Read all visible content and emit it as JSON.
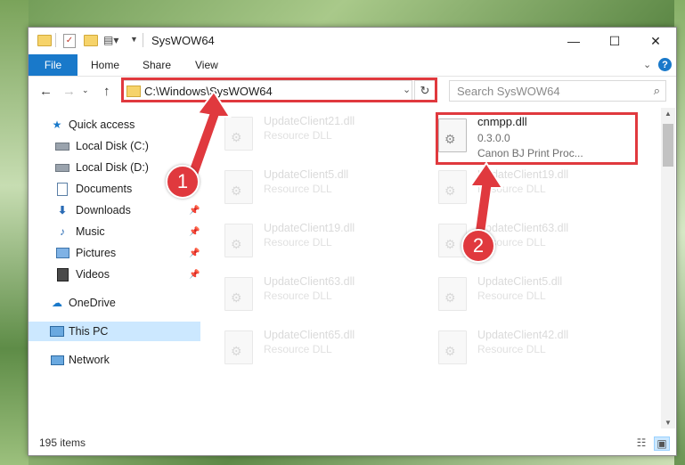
{
  "window": {
    "title": "SysWOW64"
  },
  "title_controls": {
    "minimize": "—",
    "maximize": "☐",
    "close": "✕"
  },
  "ribbon": {
    "tabs": [
      "File",
      "Home",
      "Share",
      "View"
    ],
    "help": "?"
  },
  "nav": {
    "address": "C:\\Windows\\SysWOW64",
    "search_placeholder": "Search SysWOW64"
  },
  "sidebar": {
    "items": [
      {
        "label": "Quick access",
        "icon": "star-icon",
        "pinned": false
      },
      {
        "label": "Local Disk (C:)",
        "icon": "drive-icon",
        "pinned": false
      },
      {
        "label": "Local Disk (D:)",
        "icon": "drive-icon",
        "pinned": false
      },
      {
        "label": "Documents",
        "icon": "documents-icon",
        "pinned": false
      },
      {
        "label": "Downloads",
        "icon": "downloads-icon",
        "pinned": true
      },
      {
        "label": "Music",
        "icon": "music-icon",
        "pinned": true
      },
      {
        "label": "Pictures",
        "icon": "pictures-icon",
        "pinned": true
      },
      {
        "label": "Videos",
        "icon": "videos-icon",
        "pinned": true
      },
      {
        "label": "OneDrive",
        "icon": "onedrive-icon",
        "pinned": false
      },
      {
        "label": "This PC",
        "icon": "this-pc-icon",
        "pinned": false,
        "selected": true
      },
      {
        "label": "Network",
        "icon": "network-icon",
        "pinned": false
      }
    ]
  },
  "files": [
    {
      "name": "UpdateClient21.dll",
      "desc": "Resource DLL"
    },
    {
      "name": "cnmpp.dll",
      "desc": "0.3.0.0",
      "desc2": "Canon BJ Print Proc...",
      "highlighted": true
    },
    {
      "name": "UpdateClient5.dll",
      "desc": "Resource DLL"
    },
    {
      "name": "UpdateClient19.dll",
      "desc": "Resource DLL"
    },
    {
      "name": "UpdateClient19.dll",
      "desc": "Resource DLL"
    },
    {
      "name": "UpdateClient63.dll",
      "desc": "Resource DLL"
    },
    {
      "name": "UpdateClient63.dll",
      "desc": "Resource DLL"
    },
    {
      "name": "UpdateClient5.dll",
      "desc": "Resource DLL"
    },
    {
      "name": "UpdateClient65.dll",
      "desc": "Resource DLL"
    },
    {
      "name": "UpdateClient42.dll",
      "desc": "Resource DLL"
    }
  ],
  "status": {
    "count": "195 items"
  },
  "callouts": {
    "step1": "1",
    "step2": "2"
  },
  "colors": {
    "accent": "#1979ca",
    "highlight": "#e0393e",
    "selected": "#cce8ff"
  }
}
